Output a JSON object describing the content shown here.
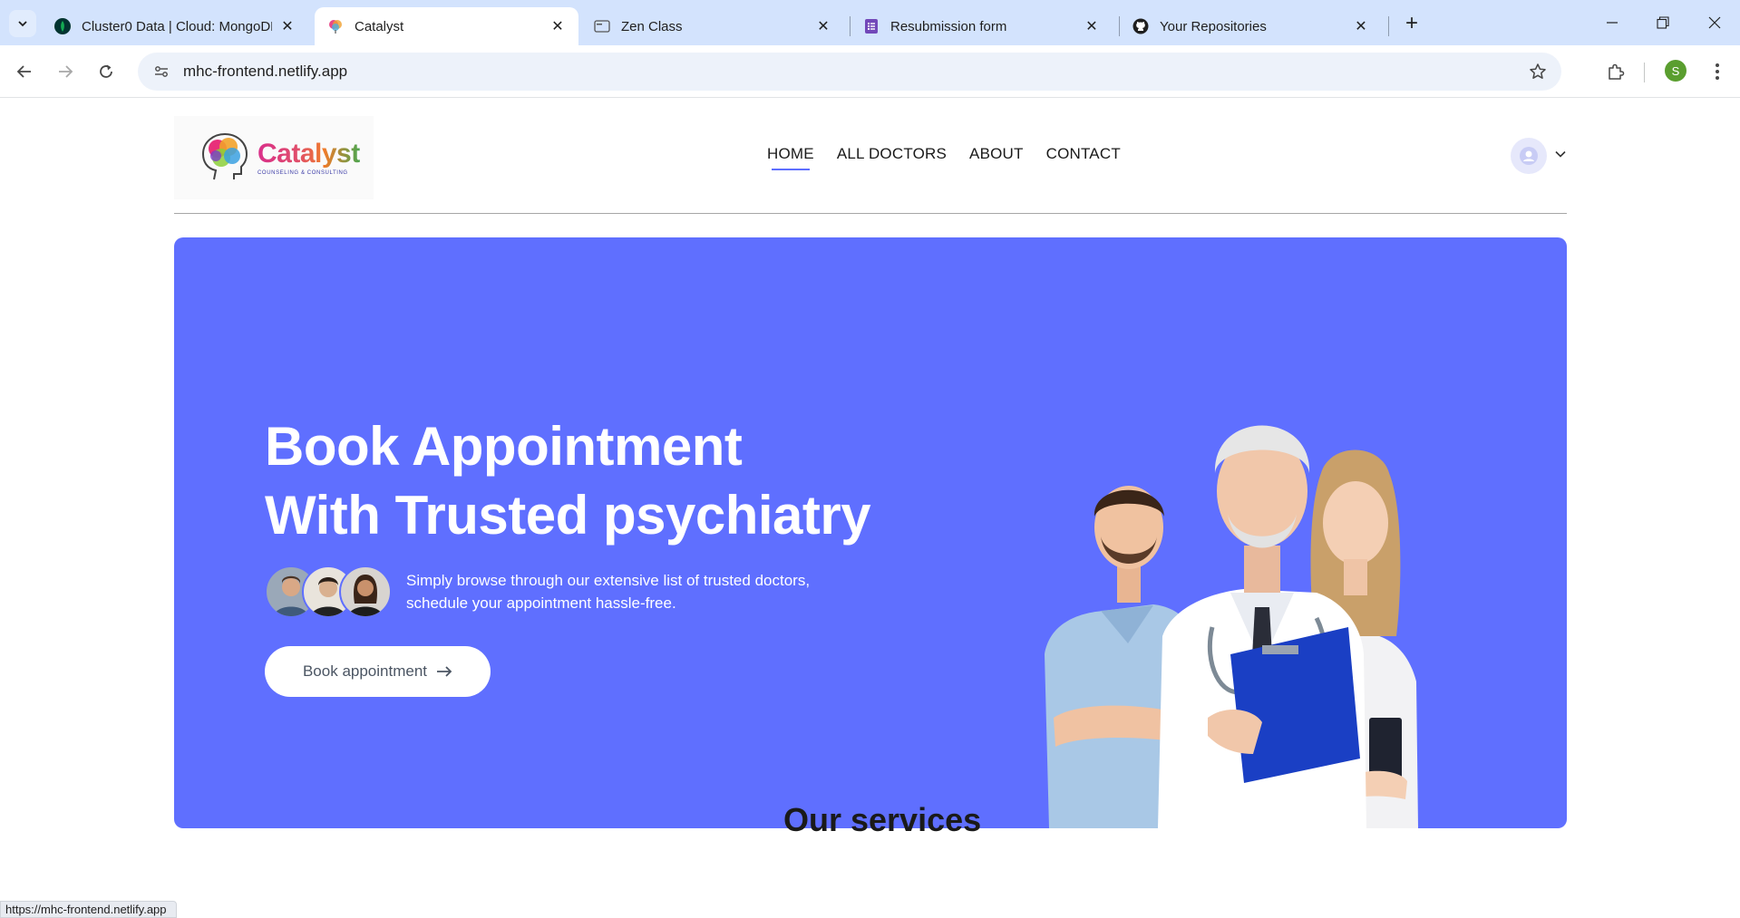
{
  "browser": {
    "tabs": [
      {
        "title": "Cluster0 Data | Cloud: MongoDB",
        "favicon": "mongodb-leaf-icon",
        "active": false
      },
      {
        "title": "Catalyst",
        "favicon": "catalyst-brain-icon",
        "active": true
      },
      {
        "title": "Zen Class",
        "favicon": "zen-class-icon",
        "active": false
      },
      {
        "title": "Resubmission form",
        "favicon": "google-forms-icon",
        "active": false
      },
      {
        "title": "Your Repositories",
        "favicon": "github-icon",
        "active": false
      }
    ],
    "url": "mhc-frontend.netlify.app",
    "profile_initial": "S",
    "status_url": "https://mhc-frontend.netlify.app"
  },
  "site": {
    "logo": {
      "name": "Catalyst",
      "tagline": "COUNSELING & CONSULTING"
    },
    "nav": [
      {
        "label": "HOME",
        "active": true
      },
      {
        "label": "ALL DOCTORS",
        "active": false
      },
      {
        "label": "ABOUT",
        "active": false
      },
      {
        "label": "CONTACT",
        "active": false
      }
    ],
    "hero": {
      "title_line1": "Book Appointment",
      "title_line2": "With Trusted psychiatry",
      "description": "Simply browse through our extensive list of trusted doctors, schedule your appointment hassle-free.",
      "button_label": "Book appointment"
    },
    "services_heading": "Our services"
  },
  "colors": {
    "primary": "#5f6fff",
    "tabbar": "#d3e3fd",
    "omnibox": "#edf2fa"
  }
}
